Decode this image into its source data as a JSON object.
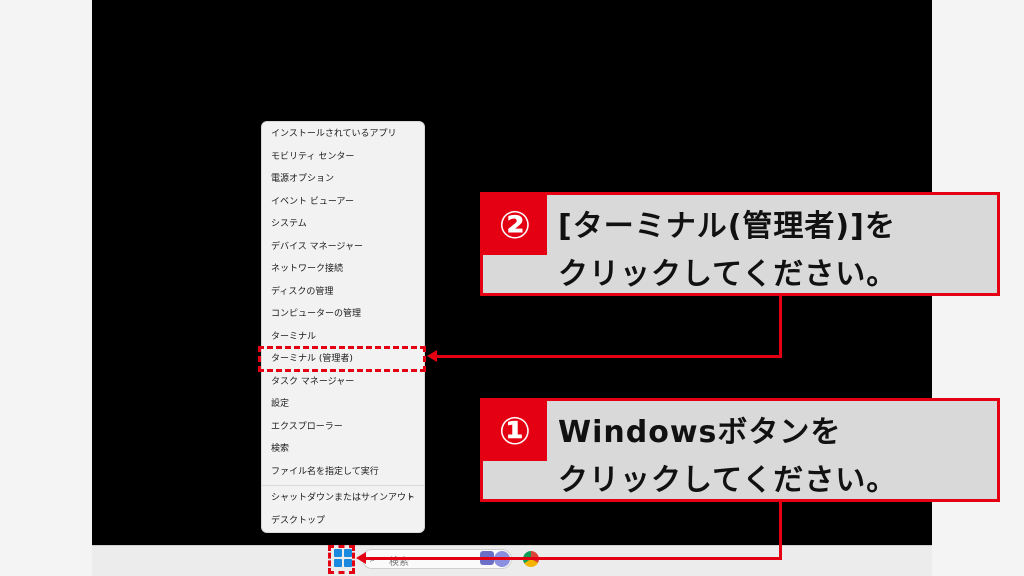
{
  "menu": {
    "items": [
      "インストールされているアプリ",
      "モビリティ センター",
      "電源オプション",
      "イベント ビューアー",
      "システム",
      "デバイス マネージャー",
      "ネットワーク接続",
      "ディスクの管理",
      "コンピューターの管理",
      "ターミナル",
      "ターミナル (管理者)",
      "タスク マネージャー",
      "設定",
      "エクスプローラー",
      "検索",
      "ファイル名を指定して実行",
      "シャットダウンまたはサインアウト",
      "デスクトップ"
    ],
    "submenu_chevron": "›"
  },
  "taskbar": {
    "search_placeholder": "検索",
    "search_icon": "search-icon",
    "icons": [
      "windows-start-icon",
      "copilot-icon",
      "chrome-icon"
    ]
  },
  "callouts": {
    "step2": {
      "number": "②",
      "line1": "[ターミナル(管理者)]を",
      "line2": "クリックしてください。"
    },
    "step1": {
      "number": "①",
      "line1": "Windowsボタンを",
      "line2": "クリックしてください。"
    }
  },
  "colors": {
    "accent": "#e40012",
    "callout_bg": "#d9d9d9",
    "menu_bg": "#f2f2f2",
    "desktop": "#000000",
    "windows_blue": "#1a8ae0"
  }
}
